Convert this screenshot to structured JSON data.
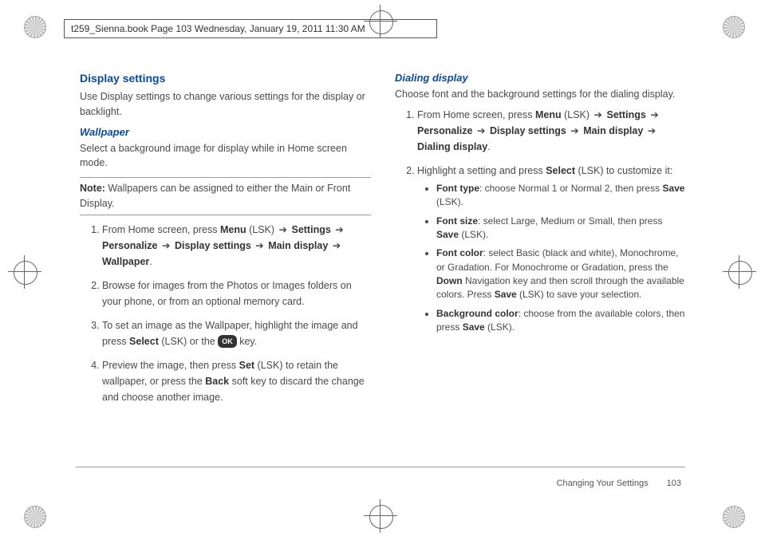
{
  "header": "t259_Sienna.book  Page 103  Wednesday, January 19, 2011  11:30 AM",
  "left": {
    "h2": "Display settings",
    "intro": "Use Display settings to change various settings for the display or backlight.",
    "sub1": "Wallpaper",
    "sub1_text": "Select a background image for display while in Home screen mode.",
    "note_label": "Note:",
    "note_text": " Wallpapers can be assigned to either the Main or Front Display.",
    "s1a": "From Home screen, press ",
    "s1_menu": "Menu",
    "s1_lsk": " (LSK) ",
    "s1_settings": "Settings",
    "s1_personalize": "Personalize",
    "s1_disp": "Display settings",
    "s1_main": "Main display",
    "s1_wall": "Wallpaper",
    "s2": "Browse for images from the Photos or Images folders on your phone, or from an optional memory card.",
    "s3a": "To set an image as the Wallpaper, highlight the image and press ",
    "s3_sel": "Select",
    "s3b": " (LSK) or the ",
    "s3_ok": "OK",
    "s3c": " key.",
    "s4a": "Preview the image, then press ",
    "s4_set": "Set",
    "s4b": " (LSK) to retain the wallpaper, or press the ",
    "s4_back": "Back",
    "s4c": " soft key to discard the change and choose another image."
  },
  "right": {
    "sub": "Dialing display",
    "intro": "Choose font and the background settings for the dialing display.",
    "s1a": "From Home screen, press ",
    "s1_menu": "Menu",
    "s1_lsk": " (LSK) ",
    "s1_settings": "Settings",
    "s1_personalize": "Personalize",
    "s1_disp": "Display settings",
    "s1_main": "Main display",
    "s1_dial": "Dialing display",
    "s2a": "Highlight a setting and press ",
    "s2_sel": "Select",
    "s2b": " (LSK) to customize it:",
    "b1_label": "Font type",
    "b1_text": ": choose Normal 1 or Normal 2, then press ",
    "b1_save": "Save",
    "b1_end": " (LSK).",
    "b2_label": "Font size",
    "b2_text": ": select Large, Medium or Small, then press ",
    "b2_save": "Save",
    "b2_end": " (LSK).",
    "b3_label": "Font color",
    "b3_text": ": select Basic (black and white), Monochrome, or Gradation. For Monochrome or Gradation, press the ",
    "b3_down": "Down",
    "b3_text2": " Navigation key and then scroll through the available colors. Press ",
    "b3_save": "Save",
    "b3_end": " (LSK) to save your selection.",
    "b4_label": "Background color",
    "b4_text": ": choose from the available colors, then press ",
    "b4_save": "Save",
    "b4_end": " (LSK)."
  },
  "footer": {
    "section": "Changing Your Settings",
    "page": "103"
  },
  "arrow": "➔"
}
